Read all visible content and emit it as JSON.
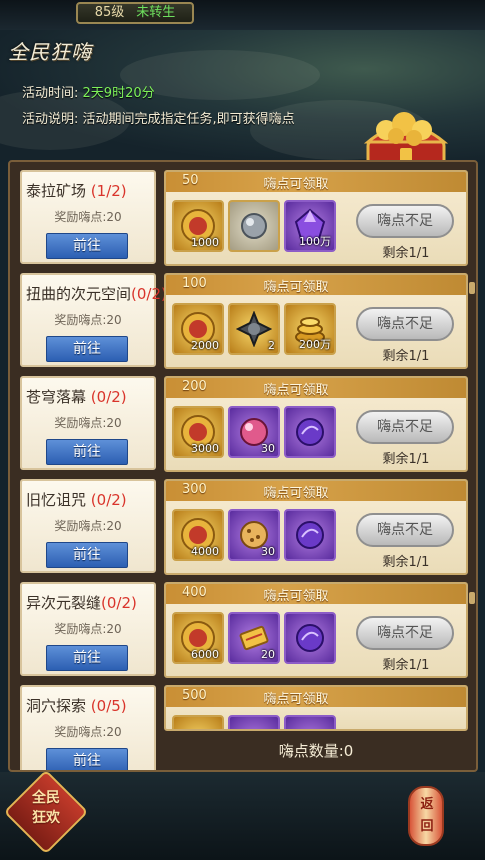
{
  "topbar": {
    "level": "85级",
    "rebirth": "未转生"
  },
  "title": "全民狂嗨",
  "activity": {
    "time_label": "活动时间:",
    "time_value": "2天9时20分",
    "desc_label": "活动说明:",
    "desc_value": "活动期间完成指定任务,即可获得嗨点"
  },
  "tasks": [
    {
      "name": "泰拉矿场",
      "progress": "(1/2)",
      "reward": "奖励嗨点:20",
      "button": "前往"
    },
    {
      "name": "扭曲的次元空间",
      "progress": "(0/2)",
      "reward": "奖励嗨点:20",
      "button": "前往"
    },
    {
      "name": "苍穹落幕",
      "progress": "(0/2)",
      "reward": "奖励嗨点:20",
      "button": "前往"
    },
    {
      "name": "旧忆诅咒",
      "progress": "(0/2)",
      "reward": "奖励嗨点:20",
      "button": "前往"
    },
    {
      "name": "异次元裂缝",
      "progress": "(0/2)",
      "reward": "奖励嗨点:20",
      "button": "前往"
    },
    {
      "name": "洞穴探索",
      "progress": "(0/5)",
      "reward": "奖励嗨点:20",
      "button": "前往"
    }
  ],
  "rewards": [
    {
      "points": "50",
      "status": "嗨点可领取",
      "items": [
        {
          "icon": "gold-coin-icon",
          "qty": "1000"
        },
        {
          "icon": "silver-orb-icon",
          "qty": ""
        },
        {
          "icon": "purple-crystal-icon",
          "qty": "100万"
        }
      ],
      "button": "嗨点不足",
      "remaining": "剩余1/1"
    },
    {
      "points": "100",
      "status": "嗨点可领取",
      "items": [
        {
          "icon": "gold-coin-icon",
          "qty": "2000"
        },
        {
          "icon": "spiked-orb-icon",
          "qty": "2"
        },
        {
          "icon": "gold-stack-icon",
          "qty": "200万"
        }
      ],
      "button": "嗨点不足",
      "remaining": "剩余1/1"
    },
    {
      "points": "200",
      "status": "嗨点可领取",
      "items": [
        {
          "icon": "gold-coin-icon",
          "qty": "3000"
        },
        {
          "icon": "pink-orb-icon",
          "qty": "30"
        },
        {
          "icon": "purple-gem-icon",
          "qty": ""
        }
      ],
      "button": "嗨点不足",
      "remaining": "剩余1/1"
    },
    {
      "points": "300",
      "status": "嗨点可领取",
      "items": [
        {
          "icon": "gold-coin-icon",
          "qty": "4000"
        },
        {
          "icon": "cookie-icon",
          "qty": "30"
        },
        {
          "icon": "purple-gem-icon",
          "qty": ""
        }
      ],
      "button": "嗨点不足",
      "remaining": "剩余1/1"
    },
    {
      "points": "400",
      "status": "嗨点可领取",
      "items": [
        {
          "icon": "gold-coin-icon",
          "qty": "6000"
        },
        {
          "icon": "gold-ticket-icon",
          "qty": "20"
        },
        {
          "icon": "purple-gem-icon",
          "qty": ""
        }
      ],
      "button": "嗨点不足",
      "remaining": "剩余1/1"
    },
    {
      "points": "500",
      "status": "嗨点可领取",
      "items": [],
      "button": "",
      "remaining": ""
    }
  ],
  "points_total": "嗨点数量:0",
  "bottom": {
    "kuanghuan_line1": "全民",
    "kuanghuan_line2": "狂欢",
    "back_line1": "返",
    "back_line2": "回"
  },
  "colors": {
    "progress": "#d9342b",
    "time": "#7ef25a",
    "button_blue": "#2c5fb2"
  }
}
